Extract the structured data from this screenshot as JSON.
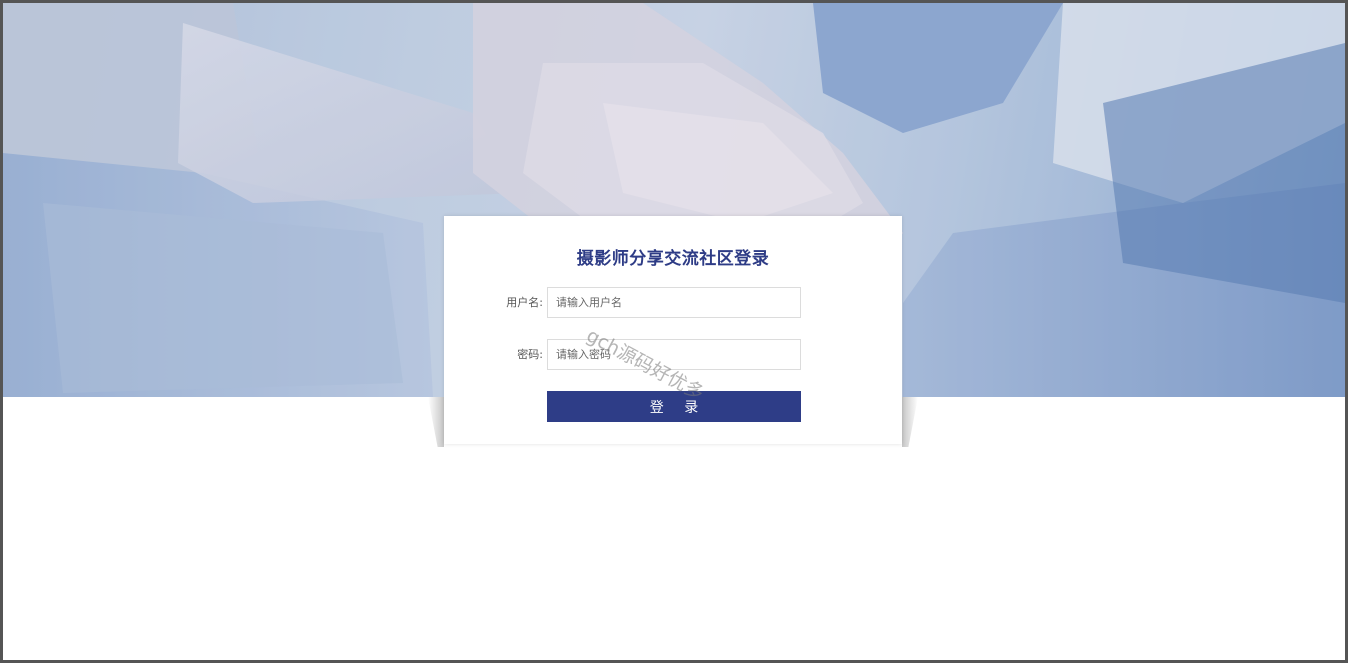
{
  "login": {
    "title": "摄影师分享交流社区登录",
    "username_label": "用户名:",
    "username_placeholder": "请输入用户名",
    "password_label": "密码:",
    "password_placeholder": "请输入密码",
    "submit_label": "登 录"
  },
  "watermark": {
    "text": "gch源码好优多"
  },
  "colors": {
    "accent": "#2e3d87",
    "title": "#2e3c86",
    "frame_border": "#555555"
  }
}
